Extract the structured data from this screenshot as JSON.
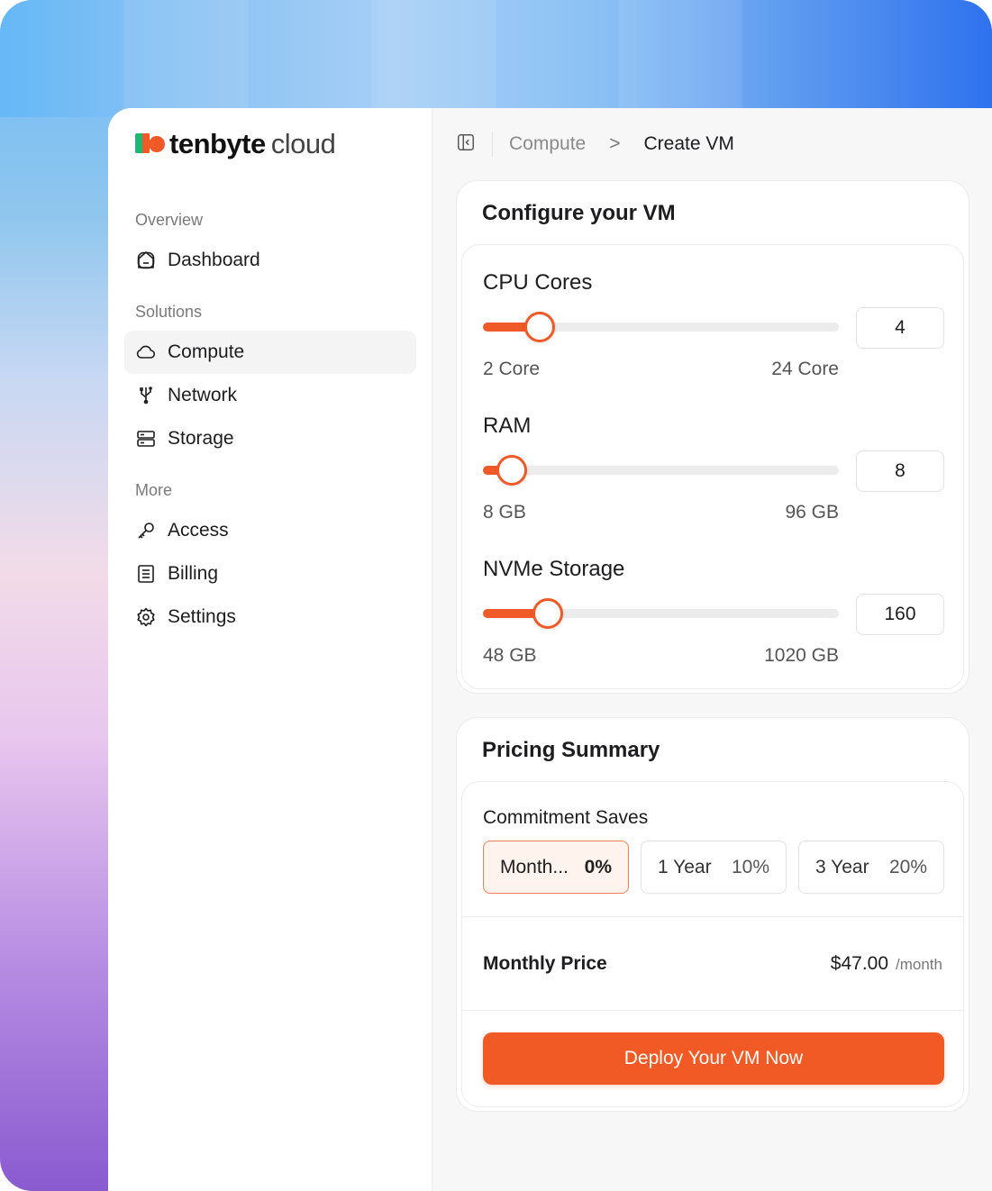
{
  "brand": {
    "name_bold": "tenbyte",
    "name_light": "cloud"
  },
  "sidebar": {
    "sections": [
      {
        "label": "Overview",
        "items": [
          {
            "label": "Dashboard",
            "icon": "dashboard-icon"
          }
        ]
      },
      {
        "label": "Solutions",
        "items": [
          {
            "label": "Compute",
            "icon": "cloud-icon",
            "active": true
          },
          {
            "label": "Network",
            "icon": "network-icon"
          },
          {
            "label": "Storage",
            "icon": "storage-icon"
          }
        ]
      },
      {
        "label": "More",
        "items": [
          {
            "label": "Access",
            "icon": "key-icon"
          },
          {
            "label": "Billing",
            "icon": "receipt-icon"
          },
          {
            "label": "Settings",
            "icon": "gear-icon"
          }
        ]
      }
    ]
  },
  "breadcrumb": {
    "parent": "Compute",
    "separator": ">",
    "current": "Create VM"
  },
  "configure": {
    "title": "Configure your VM",
    "cpu": {
      "label": "CPU Cores",
      "value": "4",
      "min_label": "2 Core",
      "max_label": "24 Core",
      "min": 2,
      "max": 24,
      "current": 4
    },
    "ram": {
      "label": "RAM",
      "value": "8",
      "min_label": "8 GB",
      "max_label": "96 GB",
      "min": 8,
      "max": 96,
      "current": 8
    },
    "storage": {
      "label": "NVMe Storage",
      "value": "160",
      "min_label": "48 GB",
      "max_label": "1020 GB",
      "min": 48,
      "max": 1020,
      "current": 160
    }
  },
  "pricing": {
    "title": "Pricing Summary",
    "commitment_label": "Commitment Saves",
    "options": [
      {
        "label": "Month...",
        "discount": "0%",
        "selected": true
      },
      {
        "label": "1 Year",
        "discount": "10%",
        "selected": false
      },
      {
        "label": "3 Year",
        "discount": "20%",
        "selected": false
      }
    ],
    "monthly_label": "Monthly Price",
    "amount": "$47.00",
    "period": "/month",
    "deploy_label": "Deploy Your VM Now"
  },
  "colors": {
    "accent": "#f05a28",
    "brand_green": "#22b573"
  }
}
